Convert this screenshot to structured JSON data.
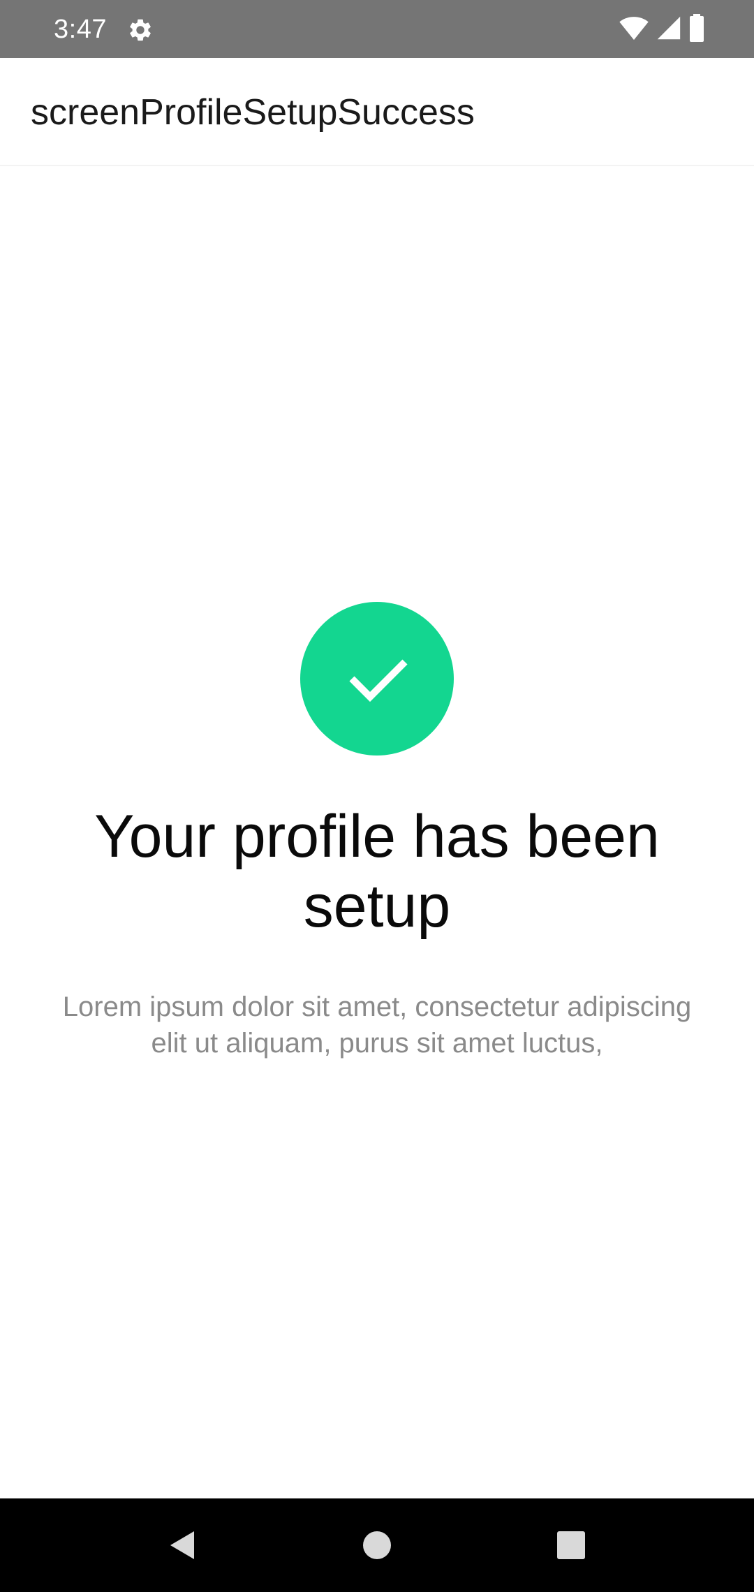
{
  "status_bar": {
    "time": "3:47",
    "icons": [
      "gear-icon",
      "wifi-icon",
      "cellular-signal-icon",
      "battery-icon"
    ]
  },
  "app_bar": {
    "title": "screenProfileSetupSuccess"
  },
  "main": {
    "success_icon": "check-icon",
    "accent_color": "#13d690",
    "headline": "Your profile has been setup",
    "body": "Lorem ipsum dolor sit amet, consectetur adipiscing elit ut aliquam, purus sit amet luctus,"
  },
  "nav_bar": {
    "buttons": [
      "back-icon",
      "home-icon",
      "recents-icon"
    ]
  }
}
